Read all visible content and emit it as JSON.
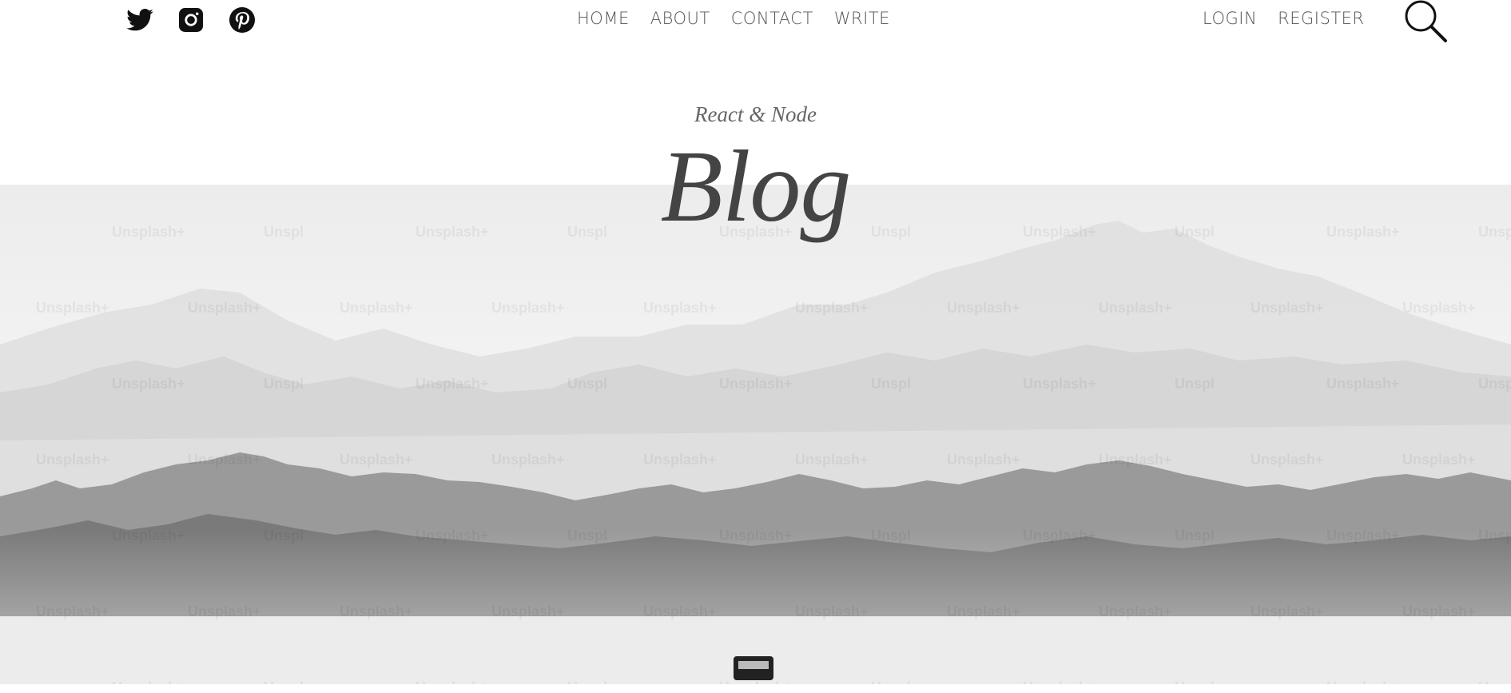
{
  "social": {
    "items": [
      {
        "name": "twitter-icon"
      },
      {
        "name": "instagram-icon"
      },
      {
        "name": "pinterest-icon"
      }
    ]
  },
  "nav": {
    "center": [
      "HOME",
      "ABOUT",
      "CONTACT",
      "WRITE"
    ],
    "right": [
      "LOGIN",
      "REGISTER"
    ],
    "search_icon": "search-icon"
  },
  "header": {
    "subtitle": "React & Node",
    "title": "Blog"
  },
  "hero": {
    "watermark_text": "Unsplash+"
  }
}
